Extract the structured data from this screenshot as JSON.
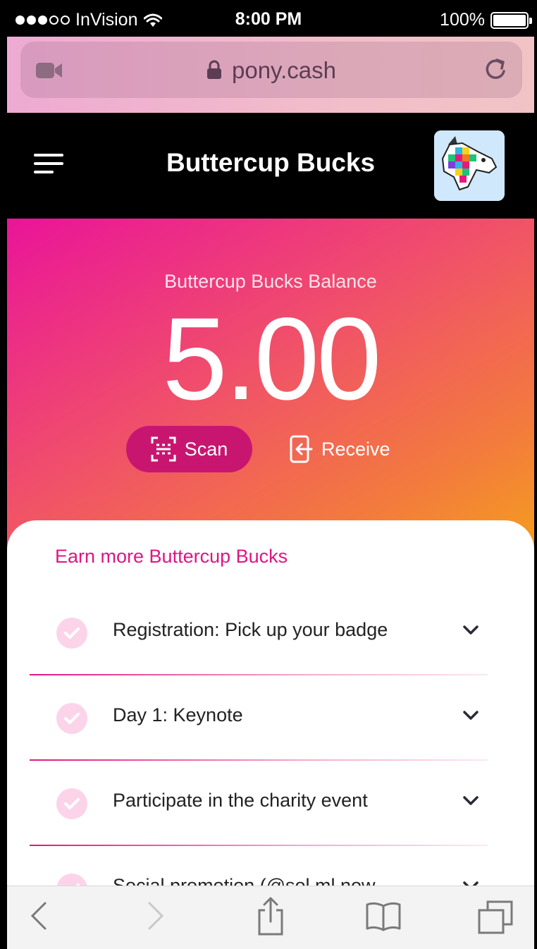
{
  "status_bar": {
    "carrier": "InVision",
    "time": "8:00 PM",
    "battery": "100%"
  },
  "browser": {
    "url": "pony.cash"
  },
  "header": {
    "title": "Buttercup Bucks"
  },
  "hero": {
    "balance_label": "Buttercup Bucks Balance",
    "balance": "5.00",
    "scan_label": "Scan",
    "receive_label": "Receive"
  },
  "earn": {
    "title": "Earn more Buttercup Bucks",
    "tasks": [
      {
        "label": "Registration: Pick up your badge"
      },
      {
        "label": "Day 1: Keynote"
      },
      {
        "label": "Participate in the charity event"
      },
      {
        "label": "Social promotion (@sol.ml.now"
      }
    ]
  },
  "colors": {
    "accent": "#e11583",
    "scan_button": "#c81670",
    "gradient_start": "#ea1499",
    "gradient_end": "#f49d1f"
  },
  "icons": [
    "wifi-icon",
    "battery-icon",
    "video-camera-icon",
    "lock-icon",
    "reload-icon",
    "hamburger-menu-icon",
    "unicorn-avatar",
    "scan-icon",
    "receive-icon",
    "check-icon",
    "chevron-down-icon",
    "back-icon",
    "forward-icon",
    "share-icon",
    "bookmarks-icon",
    "tabs-icon"
  ]
}
